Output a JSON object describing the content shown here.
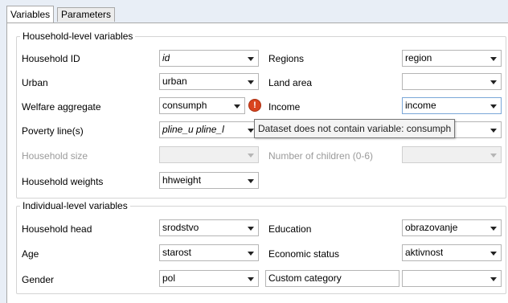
{
  "tabs": [
    {
      "label": "Variables",
      "active": true
    },
    {
      "label": "Parameters",
      "active": false
    }
  ],
  "household": {
    "title": "Household-level variables",
    "household_id": {
      "label": "Household ID",
      "value": "id"
    },
    "regions": {
      "label": "Regions",
      "value": "region"
    },
    "urban": {
      "label": "Urban",
      "value": "urban"
    },
    "land_area": {
      "label": "Land area",
      "value": ""
    },
    "welfare": {
      "label": "Welfare aggregate",
      "value": "consumph"
    },
    "income": {
      "label": "Income",
      "value": "income"
    },
    "poverty_line": {
      "label": "Poverty line(s)",
      "value": "pline_u pline_l"
    },
    "household_size": {
      "label": "Household size",
      "value": ""
    },
    "children": {
      "label": "Number of children (0-6)",
      "value": ""
    },
    "weights": {
      "label": "Household weights",
      "value": "hhweight"
    }
  },
  "individual": {
    "title": "Individual-level variables",
    "head": {
      "label": "Household head",
      "value": "srodstvo"
    },
    "education": {
      "label": "Education",
      "value": "obrazovanje"
    },
    "age": {
      "label": "Age",
      "value": "starost"
    },
    "economic": {
      "label": "Economic status",
      "value": "aktivnost"
    },
    "gender": {
      "label": "Gender",
      "value": "pol"
    },
    "custom": {
      "value": "Custom category"
    },
    "custom_combo": {
      "value": ""
    }
  },
  "tooltip": "Dataset does not contain variable: consumph",
  "icons": {
    "error": "error-icon"
  },
  "colors": {
    "error": "#d9441f",
    "focus_border": "#7aa7d8",
    "background": "#e8eef6"
  }
}
